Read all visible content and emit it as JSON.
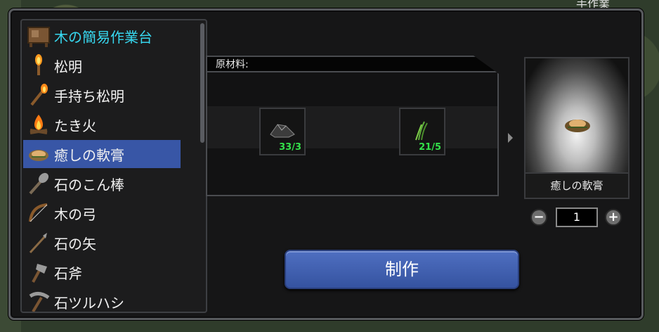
{
  "top_tab": {
    "label": "手作業"
  },
  "recipes": [
    {
      "label": "木の簡易作業台",
      "icon": "workbench-icon"
    },
    {
      "label": "松明",
      "icon": "torch-icon"
    },
    {
      "label": "手持ち松明",
      "icon": "hand-torch-icon"
    },
    {
      "label": "たき火",
      "icon": "campfire-icon"
    },
    {
      "label": "癒しの軟膏",
      "icon": "healing-salve-icon"
    },
    {
      "label": "石のこん棒",
      "icon": "stone-club-icon"
    },
    {
      "label": "木の弓",
      "icon": "wooden-bow-icon"
    },
    {
      "label": "石の矢",
      "icon": "stone-arrow-icon"
    },
    {
      "label": "石斧",
      "icon": "stone-axe-icon"
    },
    {
      "label": "石ツルハシ",
      "icon": "stone-pickaxe-icon"
    }
  ],
  "selected_recipe": "癒しの軟膏",
  "materials": {
    "header": "原材料:",
    "items": [
      {
        "icon": "stone-material-icon",
        "count": "33/3"
      },
      {
        "icon": "plant-fiber-icon",
        "count": "21/5"
      }
    ]
  },
  "output": {
    "name": "癒しの軟膏",
    "icon": "healing-salve-icon"
  },
  "quantity": {
    "value": "1",
    "minus": "−",
    "plus": "+"
  },
  "craft_button": {
    "label": "制作"
  },
  "colors": {
    "selected_row": "#3856a6",
    "highlight_text": "#37d7ef",
    "count_text": "#33e14a",
    "button": "#3d5cae"
  }
}
